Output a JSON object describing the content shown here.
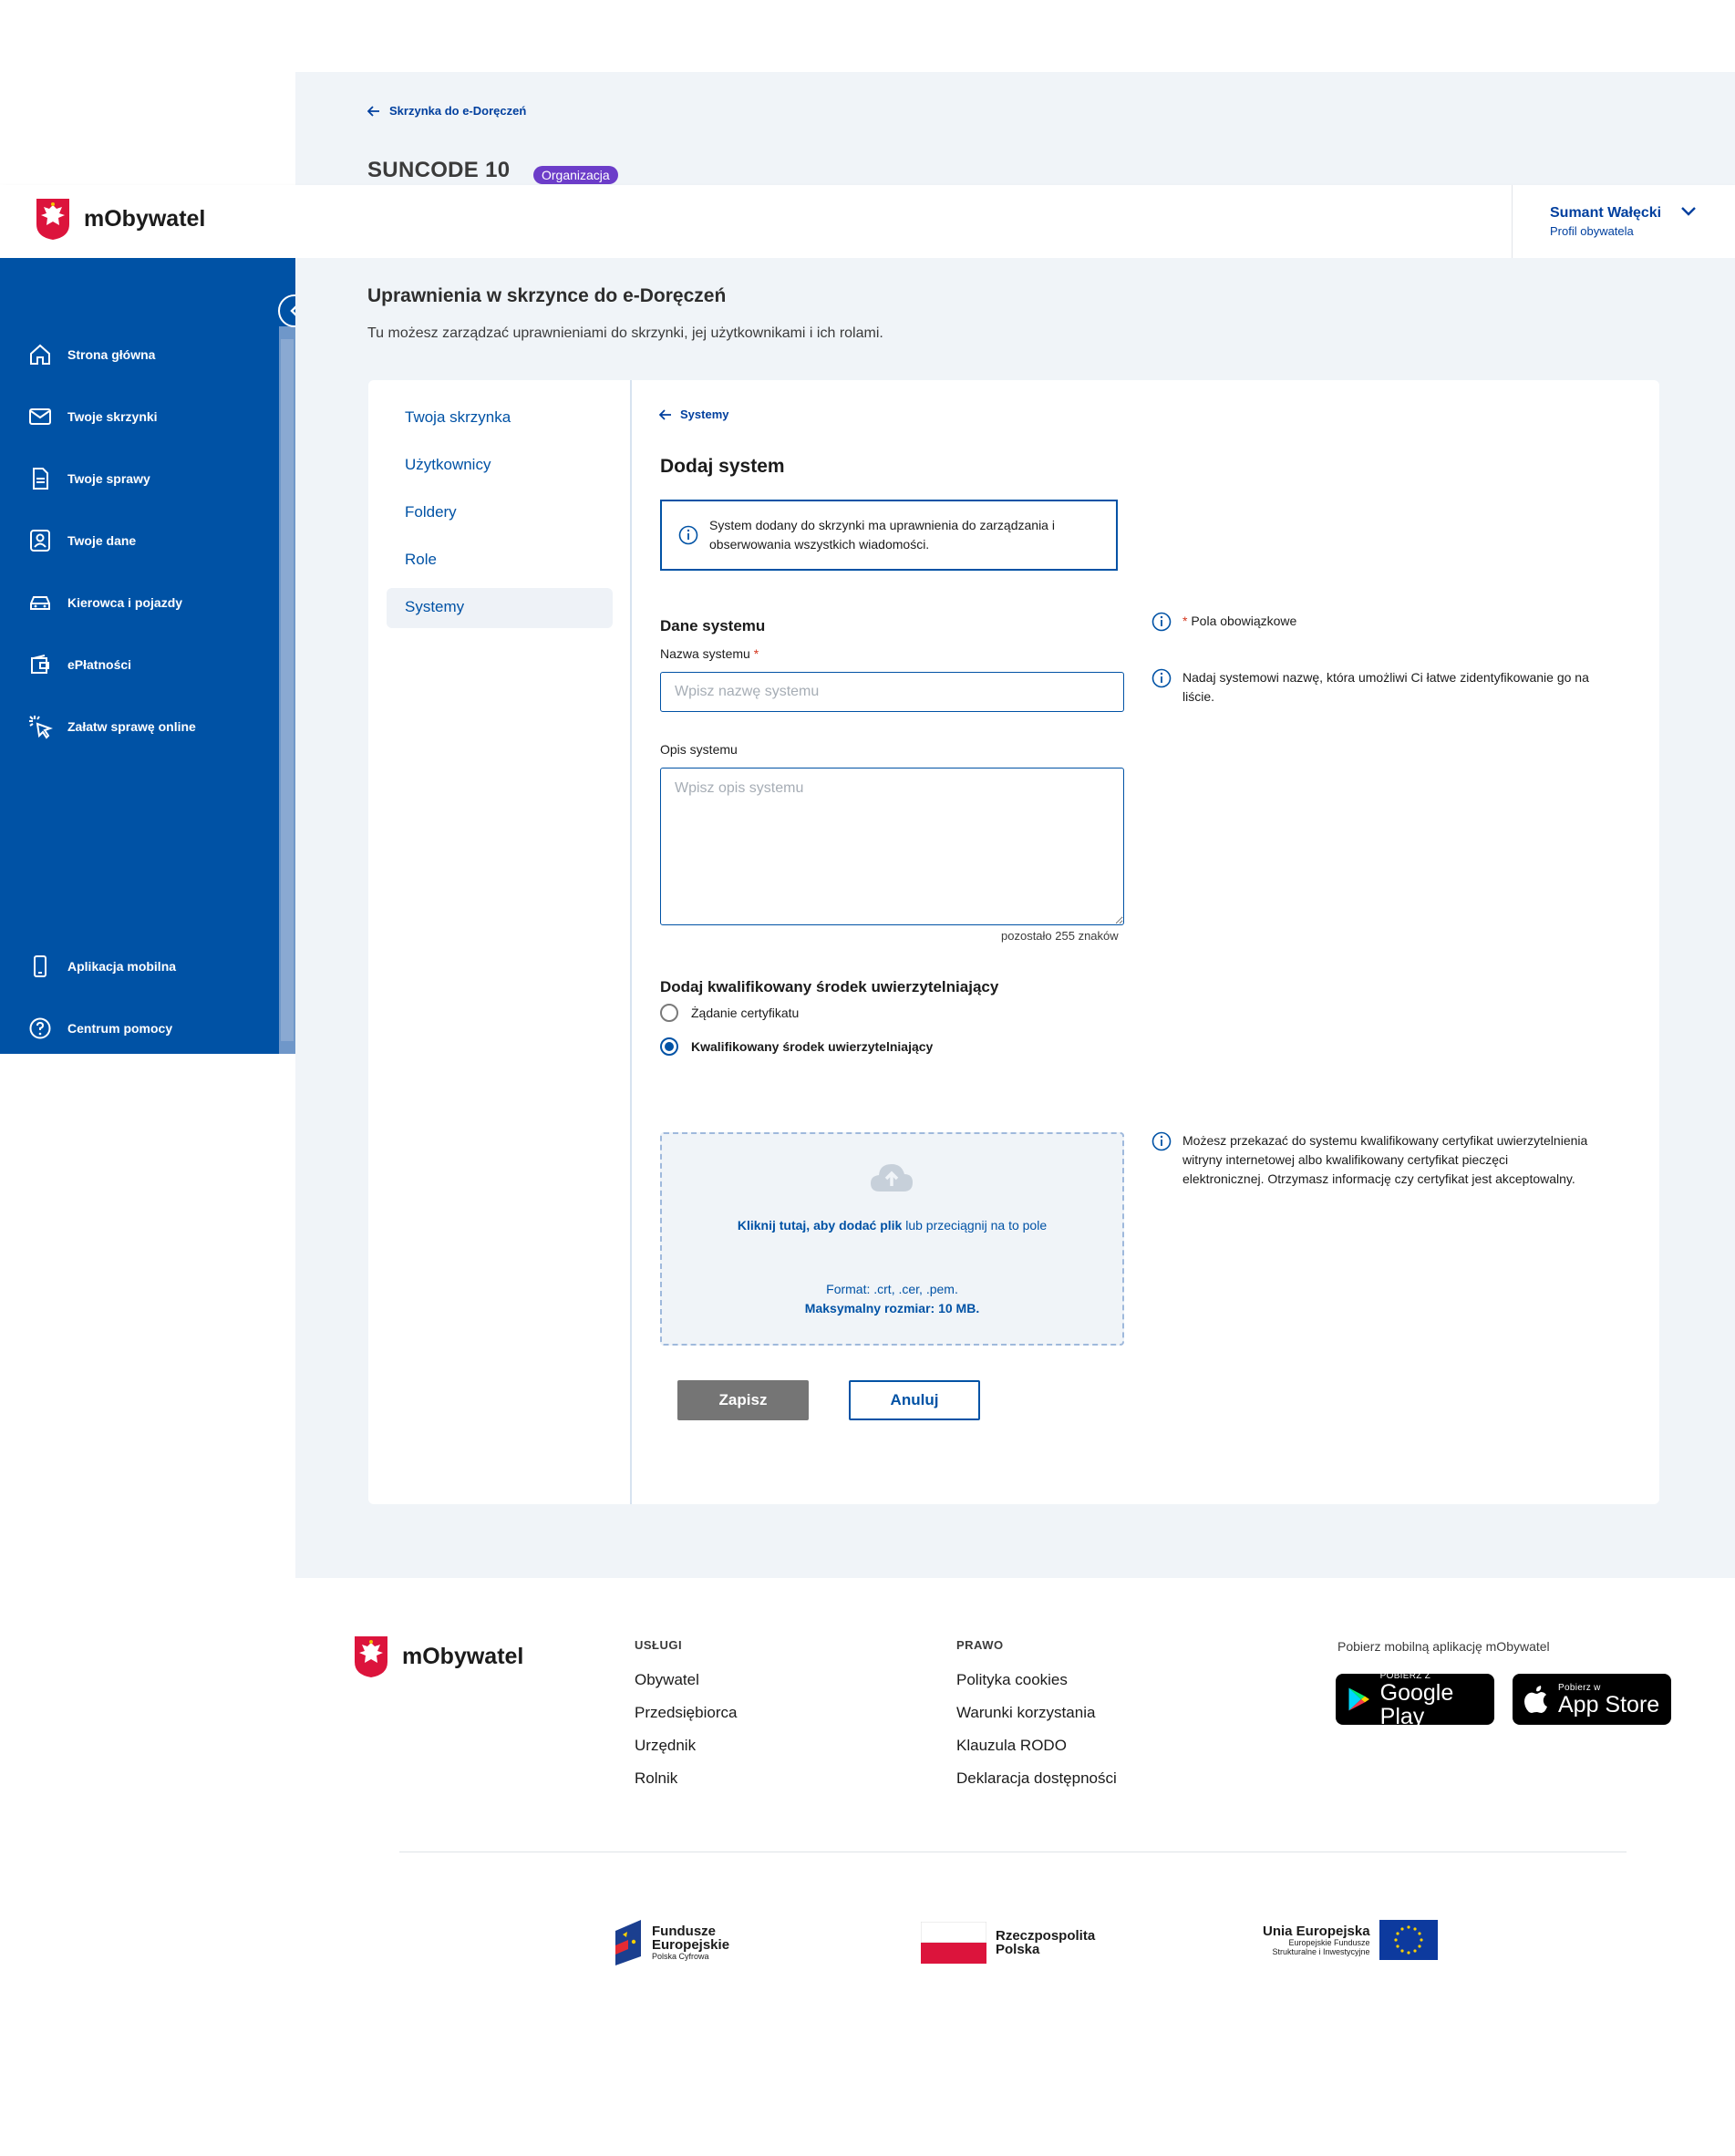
{
  "breadcrumb": {
    "back_label": "Skrzynka do e-Doręczeń"
  },
  "org": {
    "title": "SUNCODE 10",
    "badge": "Organizacja"
  },
  "header": {
    "logo_text": "mObywatel",
    "user_name": "Sumant Wałęcki",
    "user_profile": "Profil obywatela"
  },
  "sidebar": {
    "items": [
      {
        "label": "Strona główna",
        "icon": "home-icon"
      },
      {
        "label": "Twoje skrzynki",
        "icon": "mail-icon"
      },
      {
        "label": "Twoje sprawy",
        "icon": "document-icon"
      },
      {
        "label": "Twoje dane",
        "icon": "user-card-icon"
      },
      {
        "label": "Kierowca i pojazdy",
        "icon": "car-icon"
      },
      {
        "label": "ePłatności",
        "icon": "wallet-icon"
      },
      {
        "label": "Załatw sprawę online",
        "icon": "click-cursor-icon"
      }
    ],
    "bottom_items": [
      {
        "label": "Aplikacja mobilna",
        "icon": "phone-icon"
      },
      {
        "label": "Centrum pomocy",
        "icon": "help-icon"
      }
    ]
  },
  "page": {
    "heading": "Uprawnienia w skrzynce do e-Doręczeń",
    "description": "Tu możesz zarządzać uprawnieniami do skrzynki, jej użytkownikami i ich rolami."
  },
  "tabs": [
    {
      "label": "Twoja skrzynka"
    },
    {
      "label": "Użytkownicy"
    },
    {
      "label": "Foldery"
    },
    {
      "label": "Role"
    },
    {
      "label": "Systemy"
    }
  ],
  "form": {
    "back_label": "Systemy",
    "title": "Dodaj system",
    "info_line1": "System dodany do skrzynki ma uprawnienia do zarządzania i",
    "info_line2": "obserwowania wszystkich wiadomości.",
    "section_title": "Dane systemu",
    "name_label": "Nazwa systemu",
    "required_mark": "*",
    "name_placeholder": "Wpisz nazwę systemu",
    "desc_label": "Opis systemu",
    "desc_placeholder": "Wpisz opis systemu",
    "chars_left": "pozostało 255 znaków",
    "hint_required": "Pola obowiązkowe",
    "hint_name_line1": "Nadaj systemowi nazwę, która umożliwi Ci łatwe zidentyfikowanie go na",
    "hint_name_line2": "liście.",
    "auth_title": "Dodaj kwalifikowany środek uwierzytelniający",
    "radio_options": [
      {
        "label": "Żądanie certyfikatu",
        "selected": false
      },
      {
        "label": "Kwalifikowany środek uwierzytelniający",
        "selected": true
      }
    ],
    "hint_cert_line1": "Możesz przekazać do systemu kwalifikowany certyfikat uwierzytelnienia",
    "hint_cert_line2": "witryny internetowej albo kwalifikowany certyfikat pieczęci",
    "hint_cert_line3": "elektronicznej. Otrzymasz informację czy certyfikat jest akceptowalny.",
    "upload_link": "Kliknij tutaj, aby dodać plik",
    "upload_rest": " lub przeciągnij na to pole",
    "upload_format": "Format: .crt, .cer, .pem.",
    "upload_max": "Maksymalny rozmiar: 10 MB.",
    "save_label": "Zapisz",
    "cancel_label": "Anuluj"
  },
  "footer": {
    "logo_text": "mObywatel",
    "services_head": "USŁUGI",
    "services": [
      "Obywatel",
      "Przedsiębiorca",
      "Urzędnik",
      "Rolnik"
    ],
    "law_head": "PRAWO",
    "law": [
      "Polityka cookies",
      "Warunki korzystania",
      "Klauzula RODO",
      "Deklaracja dostępności"
    ],
    "download_text": "Pobierz mobilną aplikację mObywatel",
    "google_small": "POBIERZ Z",
    "google_big": "Google Play",
    "apple_small": "Pobierz w",
    "apple_big": "App Store",
    "fund1_title1": "Fundusze",
    "fund1_title2": "Europejskie",
    "fund1_sub": "Polska Cyfrowa",
    "fund2_title1": "Rzeczpospolita",
    "fund2_title2": "Polska",
    "fund3_title": "Unia Europejska",
    "fund3_sub1": "Europejskie Fundusze",
    "fund3_sub2": "Strukturalne i Inwestycyjne"
  },
  "colors": {
    "brand_blue": "#0052a5",
    "background": "#f0f4f8",
    "badge_purple": "#6c3dc9",
    "required_red": "#d4351c"
  }
}
